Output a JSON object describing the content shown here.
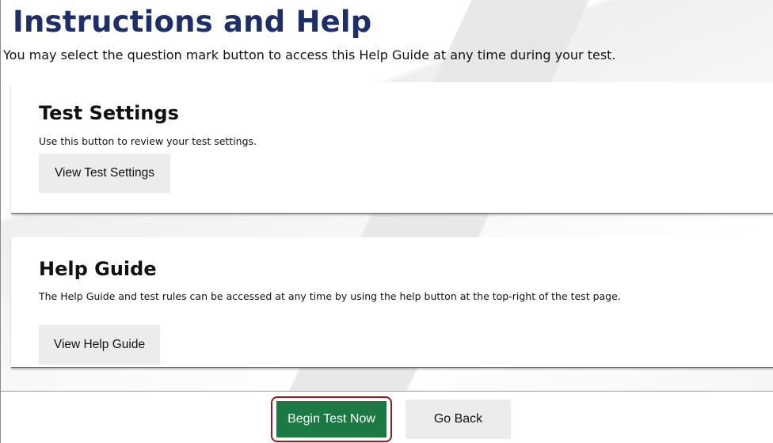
{
  "header": {
    "title": "Instructions and Help",
    "subtitle": "You may select the question mark button to access this Help Guide at any time during your test."
  },
  "sections": [
    {
      "title": "Test Settings",
      "description": "Use this button to review your test settings.",
      "button_label": "View Test Settings"
    },
    {
      "title": "Help Guide",
      "description": "The Help Guide and test rules can be accessed at any time by using the help button at the top-right of the test page.",
      "button_label": "View Help Guide"
    }
  ],
  "footer": {
    "begin_label": "Begin Test Now",
    "back_label": "Go Back"
  },
  "colors": {
    "title": "#1d2f6b",
    "begin_button": "#1b7a43",
    "focus_outline": "#8b1f24",
    "secondary_button": "#ececec"
  }
}
